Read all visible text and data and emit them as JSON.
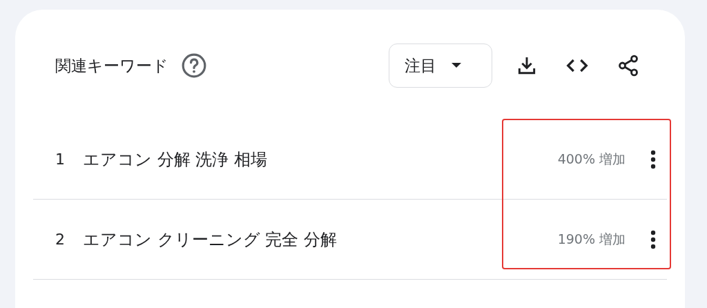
{
  "title": "関連キーワード",
  "filter": {
    "label": "注目"
  },
  "rows": [
    {
      "rank": "1",
      "keyword": "エアコン 分解 洗浄 相場",
      "change": "400% 増加"
    },
    {
      "rank": "2",
      "keyword": "エアコン クリーニング 完全 分解",
      "change": "190% 増加"
    }
  ]
}
